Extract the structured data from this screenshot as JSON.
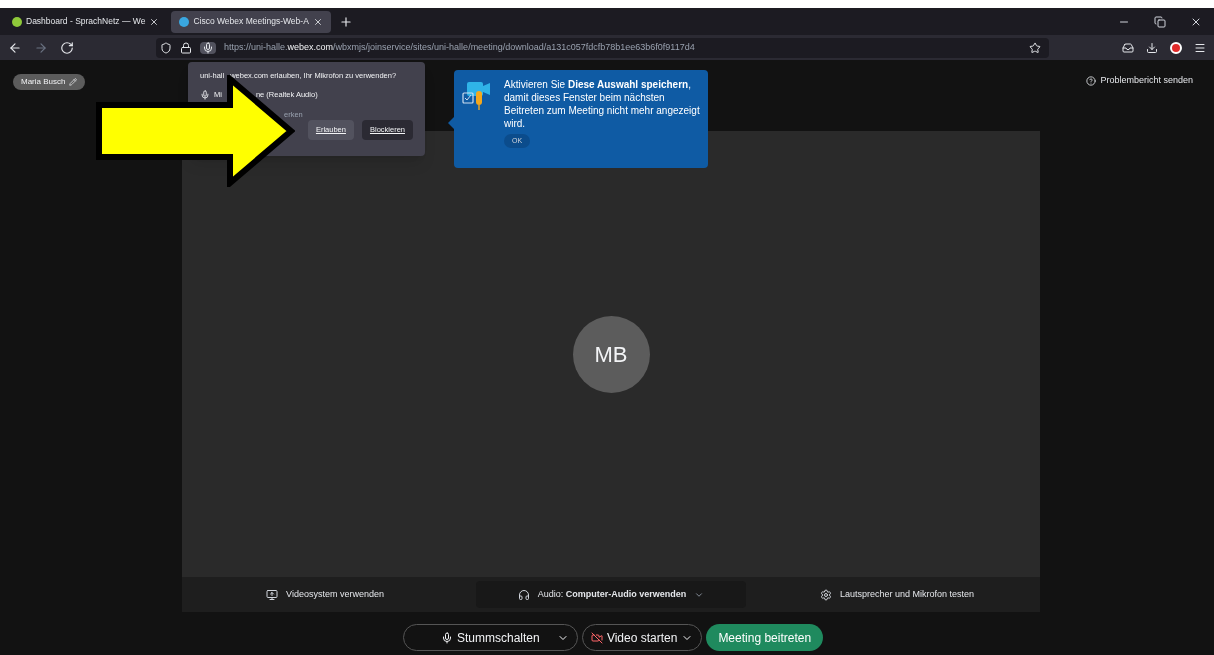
{
  "browser": {
    "tabs": [
      {
        "title": "Dashboard - SprachNetz — We",
        "selected": false
      },
      {
        "title": "Cisco Webex Meetings-Web-A",
        "selected": true
      }
    ],
    "url": {
      "host_start": "https://uni-halle.",
      "host_bold": "webex.com",
      "path": "/wbxmjs/joinservice/sites/uni-halle/meeting/download/a131c057fdcfb78b1ee63b6f0f9117d4"
    }
  },
  "permission_popup": {
    "question_start": "uni-hall",
    "question_end": "webex.com erlauben, Ihr Mikrofon zu verwenden?",
    "device_start": "Mi",
    "device_end": "ne (Realtek Audio)",
    "remember_end": "erken",
    "buttons": [
      {
        "label": "Erlauben",
        "kind": "allow"
      },
      {
        "label": "Blockieren",
        "kind": "block"
      }
    ]
  },
  "tip": {
    "text": "Aktivieren Sie **Diese Auswahl speichern**, damit dieses Fenster beim nächsten Beitreten zum Meeting nicht mehr angezeigt wird.",
    "button": "OK"
  },
  "user_name": "Maria Busch",
  "report_link": "Problembericht senden",
  "avatar_initials": "MB",
  "options": [
    {
      "kind": "video-system",
      "label": "Videosystem verwenden"
    },
    {
      "kind": "audio",
      "label": "Audio: **Computer-Audio verwenden**"
    },
    {
      "kind": "test",
      "label": "Lautsprecher und Mikrofon testen"
    }
  ],
  "controls": [
    {
      "kind": "mute",
      "label": "Stummschalten"
    },
    {
      "kind": "video",
      "label": "Video starten"
    },
    {
      "kind": "join",
      "label": "Meeting beitreten"
    }
  ]
}
